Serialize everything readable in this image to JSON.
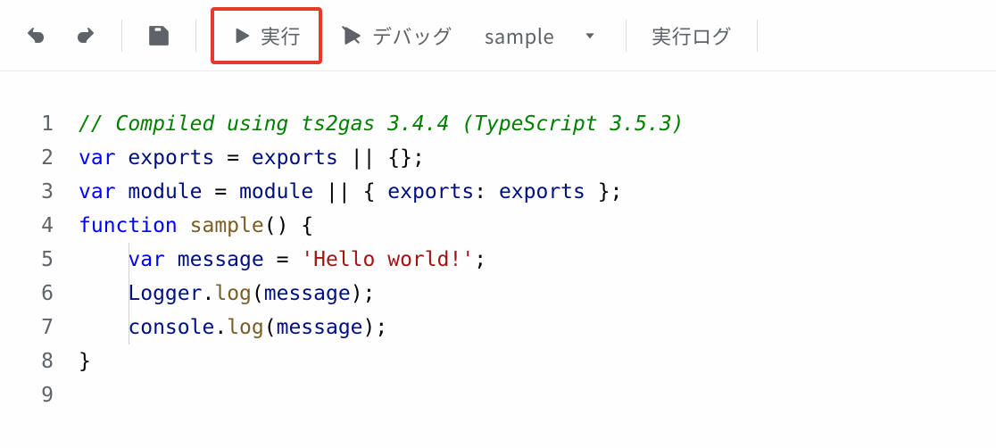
{
  "toolbar": {
    "undo_icon": "undo-icon",
    "redo_icon": "redo-icon",
    "save_icon": "save-icon",
    "run_icon": "play-icon",
    "run_label": "実行",
    "debug_icon": "debug-icon",
    "debug_label": "デバッグ",
    "function_selected": "sample",
    "dropdown_icon": "chevron-down-icon",
    "log_label": "実行ログ"
  },
  "editor": {
    "lines": [
      {
        "n": "1",
        "tokens": [
          {
            "t": "comment",
            "v": "// Compiled using ts2gas 3.4.4 (TypeScript 3.5.3)"
          }
        ]
      },
      {
        "n": "2",
        "tokens": [
          {
            "t": "keyword",
            "v": "var"
          },
          {
            "t": "plain",
            "v": " "
          },
          {
            "t": "def",
            "v": "exports"
          },
          {
            "t": "plain",
            "v": " "
          },
          {
            "t": "punct",
            "v": "="
          },
          {
            "t": "plain",
            "v": " "
          },
          {
            "t": "ident",
            "v": "exports"
          },
          {
            "t": "plain",
            "v": " "
          },
          {
            "t": "punct",
            "v": "||"
          },
          {
            "t": "plain",
            "v": " "
          },
          {
            "t": "punct",
            "v": "{};"
          }
        ]
      },
      {
        "n": "3",
        "tokens": [
          {
            "t": "keyword",
            "v": "var"
          },
          {
            "t": "plain",
            "v": " "
          },
          {
            "t": "def",
            "v": "module"
          },
          {
            "t": "plain",
            "v": " "
          },
          {
            "t": "punct",
            "v": "="
          },
          {
            "t": "plain",
            "v": " "
          },
          {
            "t": "ident",
            "v": "module"
          },
          {
            "t": "plain",
            "v": " "
          },
          {
            "t": "punct",
            "v": "||"
          },
          {
            "t": "plain",
            "v": " "
          },
          {
            "t": "punct",
            "v": "{ "
          },
          {
            "t": "field",
            "v": "exports"
          },
          {
            "t": "punct",
            "v": ": "
          },
          {
            "t": "ident",
            "v": "exports"
          },
          {
            "t": "punct",
            "v": " };"
          }
        ]
      },
      {
        "n": "4",
        "tokens": [
          {
            "t": "keyword",
            "v": "function"
          },
          {
            "t": "plain",
            "v": " "
          },
          {
            "t": "func",
            "v": "sample"
          },
          {
            "t": "punct",
            "v": "() {"
          }
        ]
      },
      {
        "n": "5",
        "indent": "    ",
        "guide": true,
        "tokens": [
          {
            "t": "keyword",
            "v": "var"
          },
          {
            "t": "plain",
            "v": " "
          },
          {
            "t": "def",
            "v": "message"
          },
          {
            "t": "plain",
            "v": " "
          },
          {
            "t": "punct",
            "v": "="
          },
          {
            "t": "plain",
            "v": " "
          },
          {
            "t": "string",
            "v": "'Hello world!'"
          },
          {
            "t": "punct",
            "v": ";"
          }
        ]
      },
      {
        "n": "6",
        "indent": "    ",
        "guide": true,
        "tokens": [
          {
            "t": "ident",
            "v": "Logger"
          },
          {
            "t": "punct",
            "v": "."
          },
          {
            "t": "func",
            "v": "log"
          },
          {
            "t": "punct",
            "v": "("
          },
          {
            "t": "ident",
            "v": "message"
          },
          {
            "t": "punct",
            "v": ");"
          }
        ]
      },
      {
        "n": "7",
        "indent": "    ",
        "guide": true,
        "tokens": [
          {
            "t": "ident",
            "v": "console"
          },
          {
            "t": "punct",
            "v": "."
          },
          {
            "t": "func",
            "v": "log"
          },
          {
            "t": "punct",
            "v": "("
          },
          {
            "t": "ident",
            "v": "message"
          },
          {
            "t": "punct",
            "v": ");"
          }
        ]
      },
      {
        "n": "8",
        "tokens": [
          {
            "t": "punct",
            "v": "}"
          }
        ]
      },
      {
        "n": "9",
        "tokens": []
      }
    ]
  }
}
